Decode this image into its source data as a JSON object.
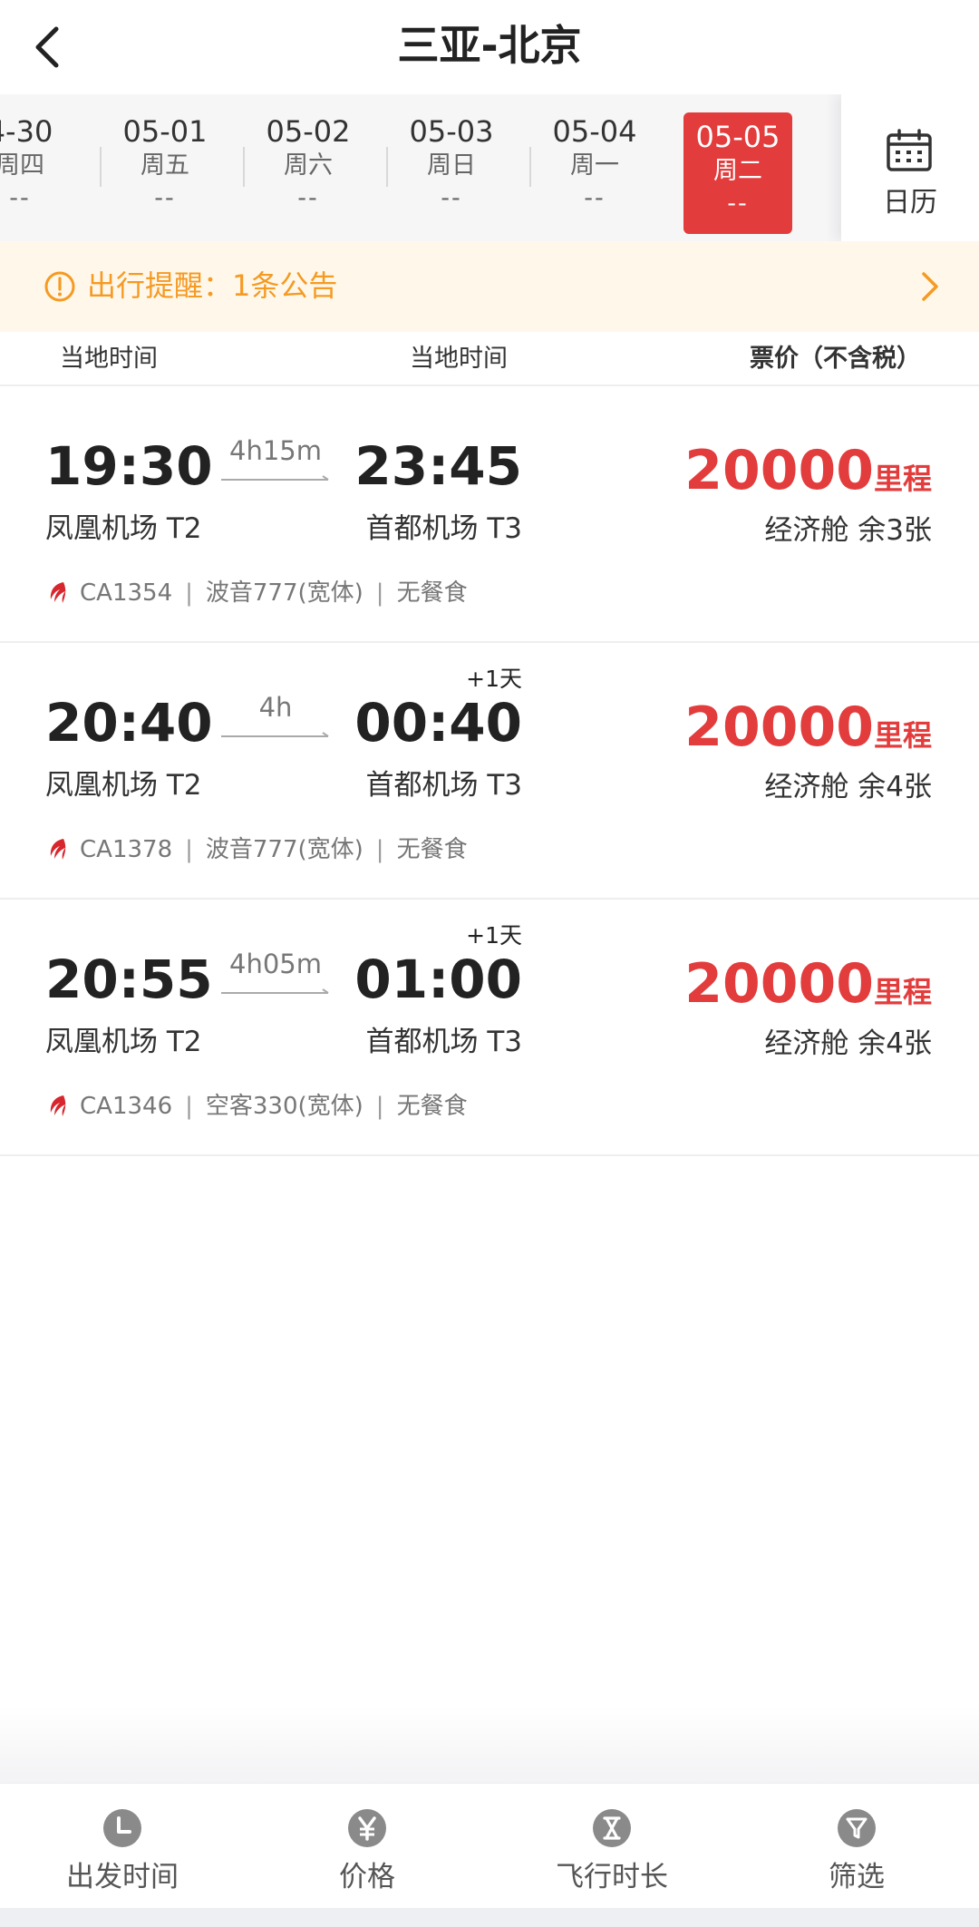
{
  "header": {
    "title": "三亚-北京"
  },
  "dates": [
    {
      "date": "4-30",
      "weekday": "周四",
      "price": "--"
    },
    {
      "date": "05-01",
      "weekday": "周五",
      "price": "--"
    },
    {
      "date": "05-02",
      "weekday": "周六",
      "price": "--"
    },
    {
      "date": "05-03",
      "weekday": "周日",
      "price": "--"
    },
    {
      "date": "05-04",
      "weekday": "周一",
      "price": "--"
    },
    {
      "date": "05-05",
      "weekday": "周二",
      "price": "--",
      "selected": true
    }
  ],
  "calendar": {
    "label": "日历"
  },
  "notice": {
    "text": "出行提醒：1条公告"
  },
  "columns": {
    "departure": "当地时间",
    "arrival": "当地时间",
    "price": "票价（不含税）"
  },
  "flights": [
    {
      "dep_time": "19:30",
      "arr_time": "23:45",
      "duration": "4h15m",
      "next_day": "",
      "dep_airport": "凤凰机场 T2",
      "arr_airport": "首都机场 T3",
      "price": "20000",
      "price_unit": "里程",
      "cabin": "经济舱 余3张",
      "flight_no": "CA1354",
      "aircraft": "波音777(宽体)",
      "meal": "无餐食"
    },
    {
      "dep_time": "20:40",
      "arr_time": "00:40",
      "duration": "4h",
      "next_day": "+1天",
      "dep_airport": "凤凰机场 T2",
      "arr_airport": "首都机场 T3",
      "price": "20000",
      "price_unit": "里程",
      "cabin": "经济舱 余4张",
      "flight_no": "CA1378",
      "aircraft": "波音777(宽体)",
      "meal": "无餐食"
    },
    {
      "dep_time": "20:55",
      "arr_time": "01:00",
      "duration": "4h05m",
      "next_day": "+1天",
      "dep_airport": "凤凰机场 T2",
      "arr_airport": "首都机场 T3",
      "price": "20000",
      "price_unit": "里程",
      "cabin": "经济舱 余4张",
      "flight_no": "CA1346",
      "aircraft": "空客330(宽体)",
      "meal": "无餐食"
    }
  ],
  "meta_separator": "|",
  "bottom_tabs": [
    {
      "label": "出发时间",
      "icon": "clock-icon"
    },
    {
      "label": "价格",
      "icon": "yuan-icon"
    },
    {
      "label": "飞行时长",
      "icon": "hourglass-icon"
    },
    {
      "label": "筛选",
      "icon": "filter-icon"
    }
  ],
  "colors": {
    "accent": "#e33c3c",
    "notice": "#f59a23",
    "notice_bg": "#fff8ea"
  }
}
